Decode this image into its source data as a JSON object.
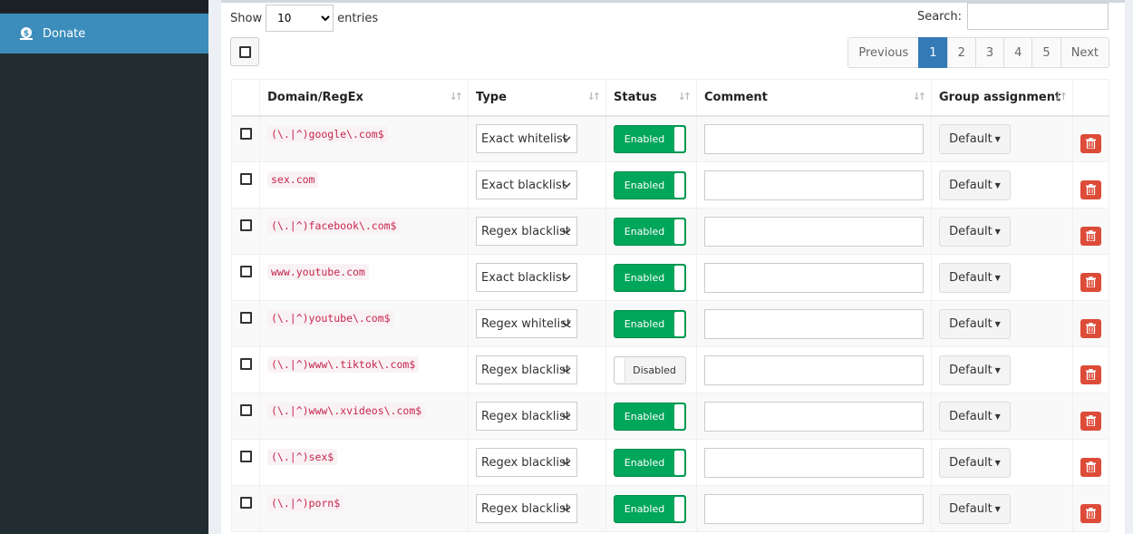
{
  "sidebar": {
    "items": [
      {
        "label": "Donate",
        "icon": "donate-icon"
      }
    ]
  },
  "toolbar": {
    "show_label": "Show",
    "entries_value": "10",
    "entries_label": "entries",
    "search_label": "Search:",
    "search_value": ""
  },
  "pagination": {
    "previous": "Previous",
    "pages": [
      "1",
      "2",
      "3",
      "4",
      "5"
    ],
    "active_page": "1",
    "next": "Next"
  },
  "table": {
    "headers": [
      "Domain/RegEx",
      "Type",
      "Status",
      "Comment",
      "Group assignment"
    ],
    "rows": [
      {
        "domain": "(\\.|^)google\\.com$",
        "type": "Exact whitelist",
        "status": "Enabled",
        "comment": "",
        "group": "Default"
      },
      {
        "domain": "sex.com",
        "type": "Exact blacklist",
        "status": "Enabled",
        "comment": "",
        "group": "Default"
      },
      {
        "domain": "(\\.|^)facebook\\.com$",
        "type": "Regex blacklist",
        "status": "Enabled",
        "comment": "",
        "group": "Default"
      },
      {
        "domain": "www.youtube.com",
        "type": "Exact blacklist",
        "status": "Enabled",
        "comment": "",
        "group": "Default"
      },
      {
        "domain": "(\\.|^)youtube\\.com$",
        "type": "Regex whitelist",
        "status": "Enabled",
        "comment": "",
        "group": "Default"
      },
      {
        "domain": "(\\.|^)www\\.tiktok\\.com$",
        "type": "Regex blacklist",
        "status": "Disabled",
        "comment": "",
        "group": "Default"
      },
      {
        "domain": "(\\.|^)www\\.xvideos\\.com$",
        "type": "Regex blacklist",
        "status": "Enabled",
        "comment": "",
        "group": "Default"
      },
      {
        "domain": "(\\.|^)sex$",
        "type": "Regex blacklist",
        "status": "Enabled",
        "comment": "",
        "group": "Default"
      },
      {
        "domain": "(\\.|^)porn$",
        "type": "Regex blacklist",
        "status": "Enabled",
        "comment": "",
        "group": "Default"
      }
    ]
  },
  "colors": {
    "sidebar": "#222d32",
    "active_nav": "#3c8dbc",
    "enabled": "#00a65a",
    "delete": "#dd4b39",
    "page_active": "#337ab7"
  }
}
